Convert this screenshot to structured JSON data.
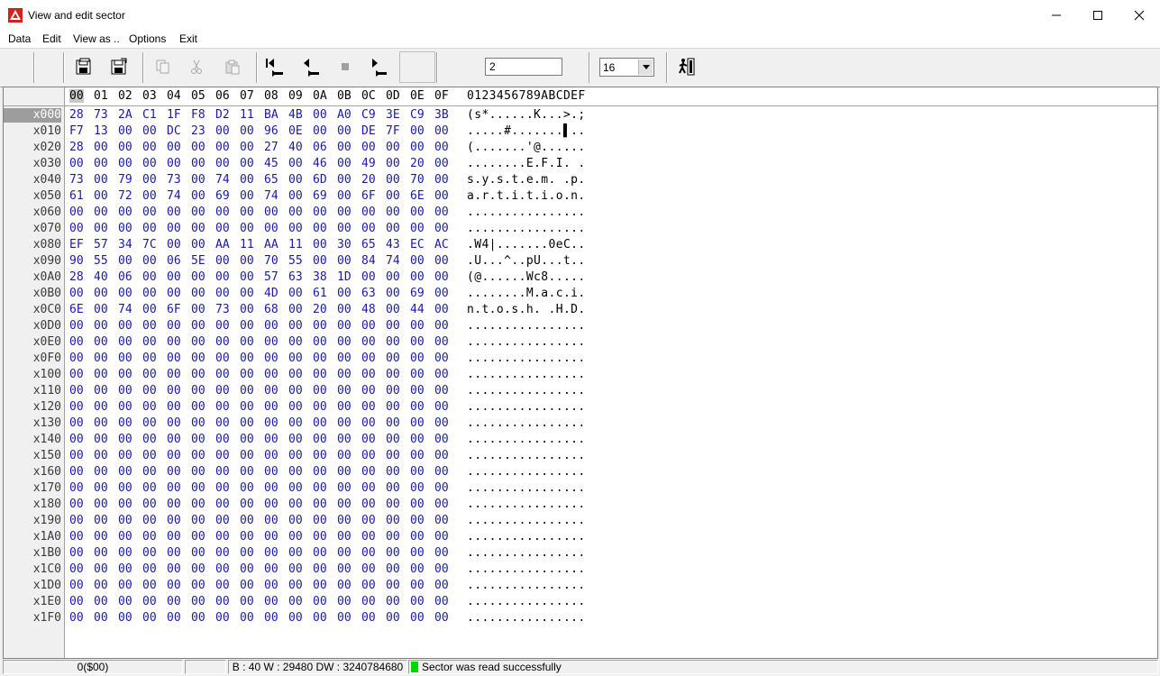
{
  "window": {
    "title": "View and edit sector"
  },
  "menu": [
    "Data",
    "Edit",
    "View as ..",
    "Options",
    "Exit"
  ],
  "toolbar": {
    "icons": [
      "save-icon",
      "save-as-icon",
      "copy-icon",
      "cut-icon",
      "paste-icon",
      "first-sector-icon",
      "previous-sector-icon",
      "stop-icon",
      "next-sector-icon",
      "exit-door-icon"
    ],
    "sector_value": "2",
    "bytes_per_row": "16"
  },
  "hex": {
    "column_headers": [
      "00",
      "01",
      "02",
      "03",
      "04",
      "05",
      "06",
      "07",
      "08",
      "09",
      "0A",
      "0B",
      "0C",
      "0D",
      "0E",
      "0F"
    ],
    "ascii_header": "0123456789ABCDEF",
    "rows": [
      {
        "addr": "x000",
        "bytes": [
          "28",
          "73",
          "2A",
          "C1",
          "1F",
          "F8",
          "D2",
          "11",
          "BA",
          "4B",
          "00",
          "A0",
          "C9",
          "3E",
          "C9",
          "3B"
        ],
        "ascii": "(s*......K...>.;"
      },
      {
        "addr": "x010",
        "bytes": [
          "F7",
          "13",
          "00",
          "00",
          "DC",
          "23",
          "00",
          "00",
          "96",
          "0E",
          "00",
          "00",
          "DE",
          "7F",
          "00",
          "00"
        ],
        "ascii": ".....#.......▌.."
      },
      {
        "addr": "x020",
        "bytes": [
          "28",
          "00",
          "00",
          "00",
          "00",
          "00",
          "00",
          "00",
          "27",
          "40",
          "06",
          "00",
          "00",
          "00",
          "00",
          "00"
        ],
        "ascii": "(.......'@......"
      },
      {
        "addr": "x030",
        "bytes": [
          "00",
          "00",
          "00",
          "00",
          "00",
          "00",
          "00",
          "00",
          "45",
          "00",
          "46",
          "00",
          "49",
          "00",
          "20",
          "00"
        ],
        "ascii": "........E.F.I. ."
      },
      {
        "addr": "x040",
        "bytes": [
          "73",
          "00",
          "79",
          "00",
          "73",
          "00",
          "74",
          "00",
          "65",
          "00",
          "6D",
          "00",
          "20",
          "00",
          "70",
          "00"
        ],
        "ascii": "s.y.s.t.e.m. .p."
      },
      {
        "addr": "x050",
        "bytes": [
          "61",
          "00",
          "72",
          "00",
          "74",
          "00",
          "69",
          "00",
          "74",
          "00",
          "69",
          "00",
          "6F",
          "00",
          "6E",
          "00"
        ],
        "ascii": "a.r.t.i.t.i.o.n."
      },
      {
        "addr": "x060",
        "bytes": [
          "00",
          "00",
          "00",
          "00",
          "00",
          "00",
          "00",
          "00",
          "00",
          "00",
          "00",
          "00",
          "00",
          "00",
          "00",
          "00"
        ],
        "ascii": "................"
      },
      {
        "addr": "x070",
        "bytes": [
          "00",
          "00",
          "00",
          "00",
          "00",
          "00",
          "00",
          "00",
          "00",
          "00",
          "00",
          "00",
          "00",
          "00",
          "00",
          "00"
        ],
        "ascii": "................"
      },
      {
        "addr": "x080",
        "bytes": [
          "EF",
          "57",
          "34",
          "7C",
          "00",
          "00",
          "AA",
          "11",
          "AA",
          "11",
          "00",
          "30",
          "65",
          "43",
          "EC",
          "AC"
        ],
        "ascii": ".W4|.......0eC.."
      },
      {
        "addr": "x090",
        "bytes": [
          "90",
          "55",
          "00",
          "00",
          "06",
          "5E",
          "00",
          "00",
          "70",
          "55",
          "00",
          "00",
          "84",
          "74",
          "00",
          "00"
        ],
        "ascii": ".U...^..pU...t.."
      },
      {
        "addr": "x0A0",
        "bytes": [
          "28",
          "40",
          "06",
          "00",
          "00",
          "00",
          "00",
          "00",
          "57",
          "63",
          "38",
          "1D",
          "00",
          "00",
          "00",
          "00"
        ],
        "ascii": "(@......Wc8....."
      },
      {
        "addr": "x0B0",
        "bytes": [
          "00",
          "00",
          "00",
          "00",
          "00",
          "00",
          "00",
          "00",
          "4D",
          "00",
          "61",
          "00",
          "63",
          "00",
          "69",
          "00"
        ],
        "ascii": "........M.a.c.i."
      },
      {
        "addr": "x0C0",
        "bytes": [
          "6E",
          "00",
          "74",
          "00",
          "6F",
          "00",
          "73",
          "00",
          "68",
          "00",
          "20",
          "00",
          "48",
          "00",
          "44",
          "00"
        ],
        "ascii": "n.t.o.s.h. .H.D."
      },
      {
        "addr": "x0D0",
        "bytes": [
          "00",
          "00",
          "00",
          "00",
          "00",
          "00",
          "00",
          "00",
          "00",
          "00",
          "00",
          "00",
          "00",
          "00",
          "00",
          "00"
        ],
        "ascii": "................"
      },
      {
        "addr": "x0E0",
        "bytes": [
          "00",
          "00",
          "00",
          "00",
          "00",
          "00",
          "00",
          "00",
          "00",
          "00",
          "00",
          "00",
          "00",
          "00",
          "00",
          "00"
        ],
        "ascii": "................"
      },
      {
        "addr": "x0F0",
        "bytes": [
          "00",
          "00",
          "00",
          "00",
          "00",
          "00",
          "00",
          "00",
          "00",
          "00",
          "00",
          "00",
          "00",
          "00",
          "00",
          "00"
        ],
        "ascii": "................"
      },
      {
        "addr": "x100",
        "bytes": [
          "00",
          "00",
          "00",
          "00",
          "00",
          "00",
          "00",
          "00",
          "00",
          "00",
          "00",
          "00",
          "00",
          "00",
          "00",
          "00"
        ],
        "ascii": "................"
      },
      {
        "addr": "x110",
        "bytes": [
          "00",
          "00",
          "00",
          "00",
          "00",
          "00",
          "00",
          "00",
          "00",
          "00",
          "00",
          "00",
          "00",
          "00",
          "00",
          "00"
        ],
        "ascii": "................"
      },
      {
        "addr": "x120",
        "bytes": [
          "00",
          "00",
          "00",
          "00",
          "00",
          "00",
          "00",
          "00",
          "00",
          "00",
          "00",
          "00",
          "00",
          "00",
          "00",
          "00"
        ],
        "ascii": "................"
      },
      {
        "addr": "x130",
        "bytes": [
          "00",
          "00",
          "00",
          "00",
          "00",
          "00",
          "00",
          "00",
          "00",
          "00",
          "00",
          "00",
          "00",
          "00",
          "00",
          "00"
        ],
        "ascii": "................"
      },
      {
        "addr": "x140",
        "bytes": [
          "00",
          "00",
          "00",
          "00",
          "00",
          "00",
          "00",
          "00",
          "00",
          "00",
          "00",
          "00",
          "00",
          "00",
          "00",
          "00"
        ],
        "ascii": "................"
      },
      {
        "addr": "x150",
        "bytes": [
          "00",
          "00",
          "00",
          "00",
          "00",
          "00",
          "00",
          "00",
          "00",
          "00",
          "00",
          "00",
          "00",
          "00",
          "00",
          "00"
        ],
        "ascii": "................"
      },
      {
        "addr": "x160",
        "bytes": [
          "00",
          "00",
          "00",
          "00",
          "00",
          "00",
          "00",
          "00",
          "00",
          "00",
          "00",
          "00",
          "00",
          "00",
          "00",
          "00"
        ],
        "ascii": "................"
      },
      {
        "addr": "x170",
        "bytes": [
          "00",
          "00",
          "00",
          "00",
          "00",
          "00",
          "00",
          "00",
          "00",
          "00",
          "00",
          "00",
          "00",
          "00",
          "00",
          "00"
        ],
        "ascii": "................"
      },
      {
        "addr": "x180",
        "bytes": [
          "00",
          "00",
          "00",
          "00",
          "00",
          "00",
          "00",
          "00",
          "00",
          "00",
          "00",
          "00",
          "00",
          "00",
          "00",
          "00"
        ],
        "ascii": "................"
      },
      {
        "addr": "x190",
        "bytes": [
          "00",
          "00",
          "00",
          "00",
          "00",
          "00",
          "00",
          "00",
          "00",
          "00",
          "00",
          "00",
          "00",
          "00",
          "00",
          "00"
        ],
        "ascii": "................"
      },
      {
        "addr": "x1A0",
        "bytes": [
          "00",
          "00",
          "00",
          "00",
          "00",
          "00",
          "00",
          "00",
          "00",
          "00",
          "00",
          "00",
          "00",
          "00",
          "00",
          "00"
        ],
        "ascii": "................"
      },
      {
        "addr": "x1B0",
        "bytes": [
          "00",
          "00",
          "00",
          "00",
          "00",
          "00",
          "00",
          "00",
          "00",
          "00",
          "00",
          "00",
          "00",
          "00",
          "00",
          "00"
        ],
        "ascii": "................"
      },
      {
        "addr": "x1C0",
        "bytes": [
          "00",
          "00",
          "00",
          "00",
          "00",
          "00",
          "00",
          "00",
          "00",
          "00",
          "00",
          "00",
          "00",
          "00",
          "00",
          "00"
        ],
        "ascii": "................"
      },
      {
        "addr": "x1D0",
        "bytes": [
          "00",
          "00",
          "00",
          "00",
          "00",
          "00",
          "00",
          "00",
          "00",
          "00",
          "00",
          "00",
          "00",
          "00",
          "00",
          "00"
        ],
        "ascii": "................"
      },
      {
        "addr": "x1E0",
        "bytes": [
          "00",
          "00",
          "00",
          "00",
          "00",
          "00",
          "00",
          "00",
          "00",
          "00",
          "00",
          "00",
          "00",
          "00",
          "00",
          "00"
        ],
        "ascii": "................"
      },
      {
        "addr": "x1F0",
        "bytes": [
          "00",
          "00",
          "00",
          "00",
          "00",
          "00",
          "00",
          "00",
          "00",
          "00",
          "00",
          "00",
          "00",
          "00",
          "00",
          "00"
        ],
        "ascii": "................"
      }
    ]
  },
  "status": {
    "offset": "0($00)",
    "values": "B : 40 W : 29480 DW : 3240784680",
    "message": "Sector was read successfully"
  },
  "colors": {
    "hex_bytes": "#1a1aa8",
    "status_ok": "#00d800",
    "accent_icon": "#d42020"
  }
}
